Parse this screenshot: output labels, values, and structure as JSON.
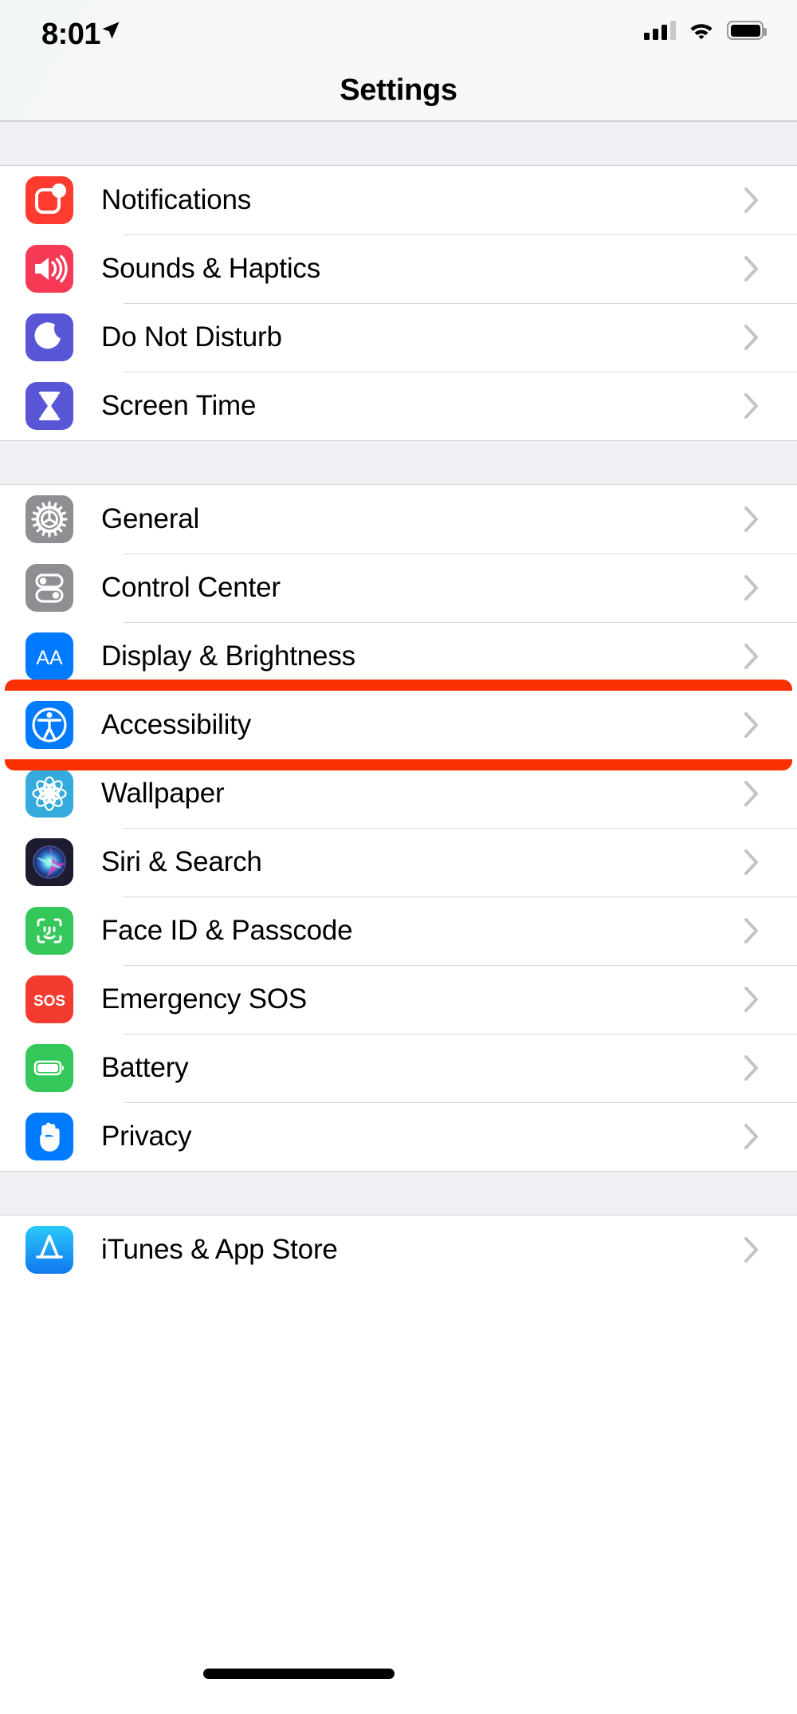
{
  "status_bar": {
    "time": "8:01",
    "location_icon": "location-arrow-icon",
    "signal_icon": "cellular-signal-icon",
    "wifi_icon": "wifi-icon",
    "battery_icon": "battery-icon"
  },
  "nav": {
    "title": "Settings"
  },
  "groups": [
    {
      "rows": [
        {
          "label": "Notifications",
          "icon": "notifications-icon",
          "color": "#FF3B30",
          "chevron": "chevron-right-icon"
        },
        {
          "label": "Sounds & Haptics",
          "icon": "speaker-icon",
          "color": "#F63A55",
          "chevron": "chevron-right-icon"
        },
        {
          "label": "Do Not Disturb",
          "icon": "moon-icon",
          "color": "#5855D6",
          "chevron": "chevron-right-icon"
        },
        {
          "label": "Screen Time",
          "icon": "hourglass-icon",
          "color": "#5855D6",
          "chevron": "chevron-right-icon"
        }
      ]
    },
    {
      "rows": [
        {
          "label": "General",
          "icon": "gear-icon",
          "color": "#8E8E93",
          "chevron": "chevron-right-icon"
        },
        {
          "label": "Control Center",
          "icon": "toggles-icon",
          "color": "#8E8E93",
          "chevron": "chevron-right-icon"
        },
        {
          "label": "Display & Brightness",
          "icon": "text-size-aa-icon",
          "color": "#007AFF",
          "chevron": "chevron-right-icon"
        },
        {
          "label": "Accessibility",
          "icon": "accessibility-icon",
          "color": "#007AFF",
          "chevron": "chevron-right-icon",
          "highlighted": true
        },
        {
          "label": "Wallpaper",
          "icon": "flower-icon",
          "color": "#35AADC",
          "chevron": "chevron-right-icon"
        },
        {
          "label": "Siri & Search",
          "icon": "siri-orb-icon",
          "color": "#1C1C2E",
          "chevron": "chevron-right-icon"
        },
        {
          "label": "Face ID & Passcode",
          "icon": "face-id-icon",
          "color": "#34C759",
          "chevron": "chevron-right-icon"
        },
        {
          "label": "Emergency SOS",
          "icon": "sos-icon",
          "color": "#F43B30",
          "chevron": "chevron-right-icon"
        },
        {
          "label": "Battery",
          "icon": "battery-full-icon",
          "color": "#34C759",
          "chevron": "chevron-right-icon"
        },
        {
          "label": "Privacy",
          "icon": "hand-raised-icon",
          "color": "#007AFF",
          "chevron": "chevron-right-icon"
        }
      ]
    },
    {
      "rows": [
        {
          "label": "iTunes & App Store",
          "icon": "app-store-icon",
          "color": "#1BAFFD",
          "chevron": "chevron-right-icon"
        }
      ]
    }
  ],
  "highlight": {
    "target_label": "Accessibility",
    "color": "#FA3000"
  },
  "home_indicator": {
    "icon": "home-indicator-bar"
  }
}
